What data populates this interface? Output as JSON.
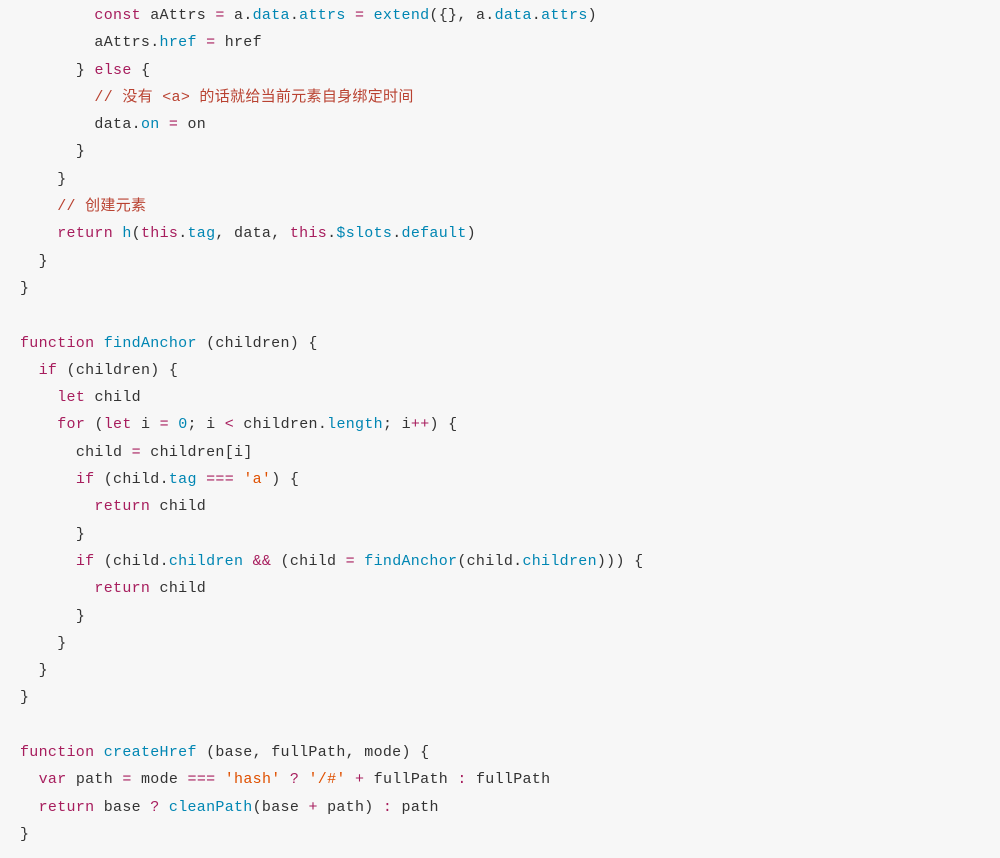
{
  "code": {
    "tokens": {
      "const": "const",
      "let": "let",
      "var": "var",
      "if": "if",
      "else": "else",
      "for": "for",
      "return": "return",
      "function": "function",
      "this": "this",
      "aAttrs": "aAttrs",
      "a": "a",
      "data": "data",
      "attrs": "attrs",
      "extend": "extend",
      "href": "href",
      "on": "on",
      "h": "h",
      "tag": "tag",
      "slots": "$slots",
      "default": "default",
      "findAnchor": "findAnchor",
      "children": "children",
      "child": "child",
      "i": "i",
      "zero": "0",
      "length": "length",
      "stra": "'a'",
      "createHref": "createHref",
      "base": "base",
      "fullPath": "fullPath",
      "mode": "mode",
      "path": "path",
      "strhash": "'hash'",
      "strslashhash": "'/#'",
      "cleanPath": "cleanPath",
      "comment1": "// 没有 <a> 的话就给当前元素自身绑定时间",
      "comment2": "// 创建元素"
    }
  }
}
